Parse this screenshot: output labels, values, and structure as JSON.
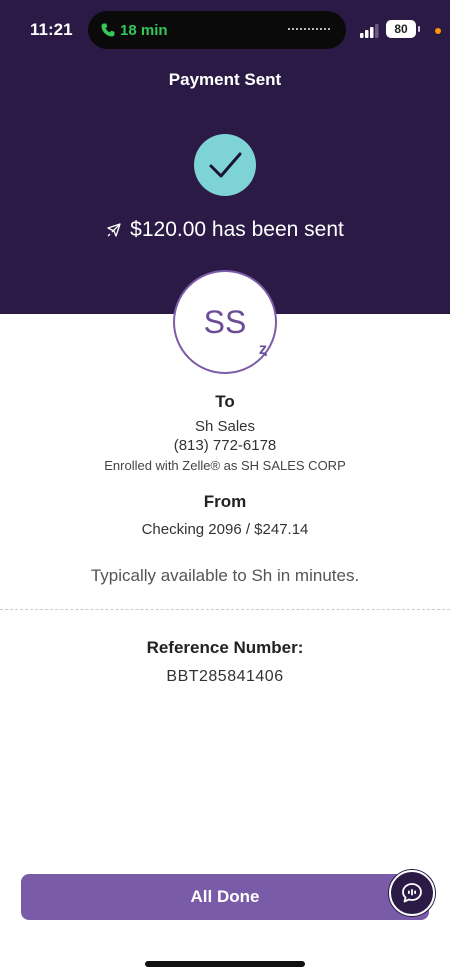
{
  "status_bar": {
    "time": "11:21",
    "call_duration": "18 min",
    "battery": "80"
  },
  "header": {
    "title": "Payment Sent",
    "sent_message": "$120.00 has been sent",
    "background_color": "#2b1a45",
    "check_color": "#7dd3d6"
  },
  "recipient": {
    "initials": "SS",
    "to_label": "To",
    "name": "Sh Sales",
    "phone": "(813) 772-6178",
    "enrolled": "Enrolled with Zelle® as SH SALES CORP"
  },
  "source": {
    "from_label": "From",
    "account": "Checking 2096 / $247.14"
  },
  "availability": "Typically available to Sh in minutes.",
  "reference": {
    "label": "Reference Number:",
    "value": "BBT285841406"
  },
  "actions": {
    "done_label": "All Done",
    "accent_color": "#7a5ba8"
  },
  "icons": [
    "phone-icon",
    "signal-icon",
    "check-icon",
    "rocket-icon",
    "zelle-icon",
    "chat-icon"
  ]
}
